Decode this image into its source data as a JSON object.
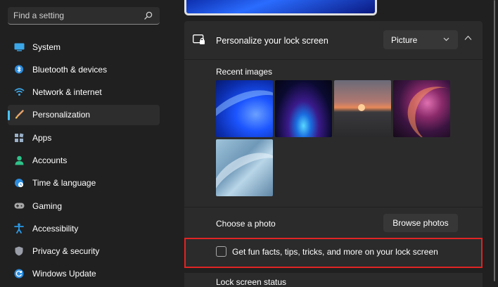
{
  "search": {
    "placeholder": "Find a setting"
  },
  "sidebar": {
    "items": [
      {
        "label": "System",
        "icon": "system-icon"
      },
      {
        "label": "Bluetooth & devices",
        "icon": "bluetooth-icon"
      },
      {
        "label": "Network & internet",
        "icon": "wifi-icon"
      },
      {
        "label": "Personalization",
        "icon": "brush-icon",
        "active": true
      },
      {
        "label": "Apps",
        "icon": "apps-icon"
      },
      {
        "label": "Accounts",
        "icon": "person-icon"
      },
      {
        "label": "Time & language",
        "icon": "globe-clock-icon"
      },
      {
        "label": "Gaming",
        "icon": "gamepad-icon"
      },
      {
        "label": "Accessibility",
        "icon": "accessibility-icon"
      },
      {
        "label": "Privacy & security",
        "icon": "shield-icon"
      },
      {
        "label": "Windows Update",
        "icon": "update-icon"
      }
    ]
  },
  "lock_screen": {
    "title": "Personalize your lock screen",
    "dropdown_value": "Picture",
    "recent_images_label": "Recent images",
    "recent_images": [
      "blue-bloom-image",
      "blue-glow-image",
      "sunset-lake-image",
      "purple-ribbon-image",
      "pale-blue-bloom-image"
    ],
    "choose_photo_label": "Choose a photo",
    "browse_label": "Browse photos",
    "fun_facts_label": "Get fun facts, tips, tricks, and more on your lock screen",
    "fun_facts_checked": false,
    "next_section_label": "Lock screen status"
  },
  "colors": {
    "background": "#202020",
    "card": "#2b2b2b",
    "accent": "#4cc2ff",
    "highlight": "#e02424"
  }
}
